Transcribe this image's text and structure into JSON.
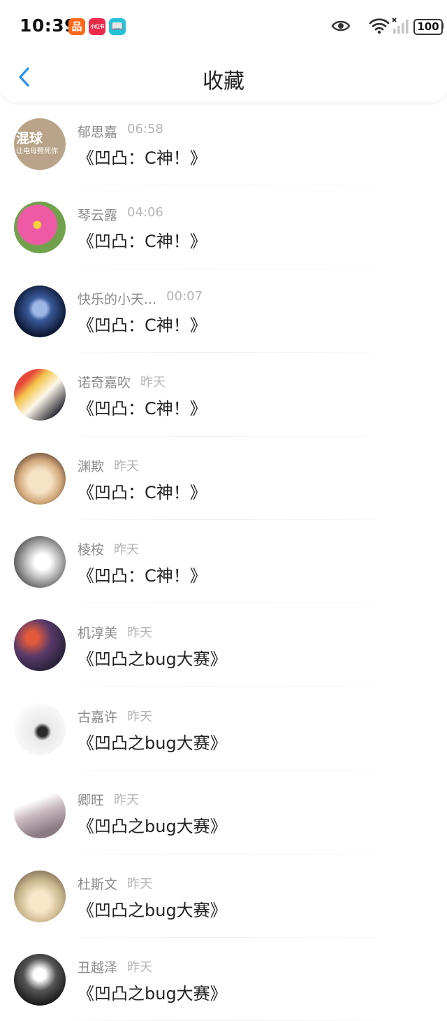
{
  "status_bar": {
    "time": "10:39",
    "app_icons": [
      {
        "name": "kuaishou-icon",
        "glyph": "品",
        "color": "#ff6a1a"
      },
      {
        "name": "xiaohongshu-icon",
        "glyph": "小红书",
        "color": "#ee2a4a"
      },
      {
        "name": "reader-icon",
        "glyph": "📖",
        "color": "#23c2d8"
      }
    ],
    "battery": "100"
  },
  "header": {
    "title": "收藏",
    "accent_color": "#2e93e8"
  },
  "favorites": [
    {
      "user": "郁思嘉",
      "time": "06:58",
      "title": "《凹凸：C神！》",
      "avatar_bg": "#b9a489",
      "avatar_text": "混球",
      "avatar_sub": "让电母劈死你"
    },
    {
      "user": "琴云露",
      "time": "04:06",
      "title": "《凹凸：C神！》",
      "avatar_bg": "radial-gradient(circle at 45% 45%, #f7d23a 0 9%, #ee5aa6 11% 48%, #6fa24a 52%)"
    },
    {
      "user": "快乐的小天...",
      "time": "00:07",
      "title": "《凹凸：C神！》",
      "avatar_bg": "radial-gradient(circle at 50% 45%, #9fb7e6 0 18%, #3a5a9a 30%, #0d1833 70%)"
    },
    {
      "user": "诺奇嘉吹",
      "time": "昨天",
      "title": "《凹凸：C神！》",
      "avatar_bg": "linear-gradient(135deg, #e8473a 0 22%, #f4c44a 35%, #fdf7ea 55%, #2b2b33 85%)"
    },
    {
      "user": "渊欺",
      "time": "昨天",
      "title": "《凹凸：C神！》",
      "avatar_bg": "radial-gradient(circle at 50% 55%, #f6e2c4 0 30%, #d2a87a 55%, #4f3a2d 85%)"
    },
    {
      "user": "棱桉",
      "time": "昨天",
      "title": "《凹凸：C神！》",
      "avatar_bg": "radial-gradient(circle at 55% 50%, #ffffff 0 20%, #b8b8b8 45%, #3c3c3c 85%)"
    },
    {
      "user": "机淳美",
      "time": "昨天",
      "title": "《凹凸之bug大赛》",
      "avatar_bg": "radial-gradient(circle at 35% 35%, #e25a3a 0 12%, #5a3a6a 40%, #1a1a2a 85%)"
    },
    {
      "user": "古嘉许",
      "time": "昨天",
      "title": "《凹凸之bug大赛》",
      "avatar_bg": "radial-gradient(circle at 55% 55%, #2a2a2a 0 12%, #e9e9e9 22%, #fafafa 70%)"
    },
    {
      "user": "卿旺",
      "time": "昨天",
      "title": "《凹凸之bug大赛》",
      "avatar_bg": "linear-gradient(160deg, #ffffff 0 30%, #cbbcc2 50%, #8a7a82 80%)"
    },
    {
      "user": "杜斯文",
      "time": "昨天",
      "title": "《凹凸之bug大赛》",
      "avatar_bg": "radial-gradient(circle at 50% 60%, #f7e6c8 0 25%, #c8b48a 55%, #6b5a4a 90%)"
    },
    {
      "user": "丑越泽",
      "time": "昨天",
      "title": "《凹凸之bug大赛》",
      "avatar_bg": "radial-gradient(circle at 50% 40%, #ffffff 0 15%, #555 40%, #111 80%)"
    }
  ]
}
